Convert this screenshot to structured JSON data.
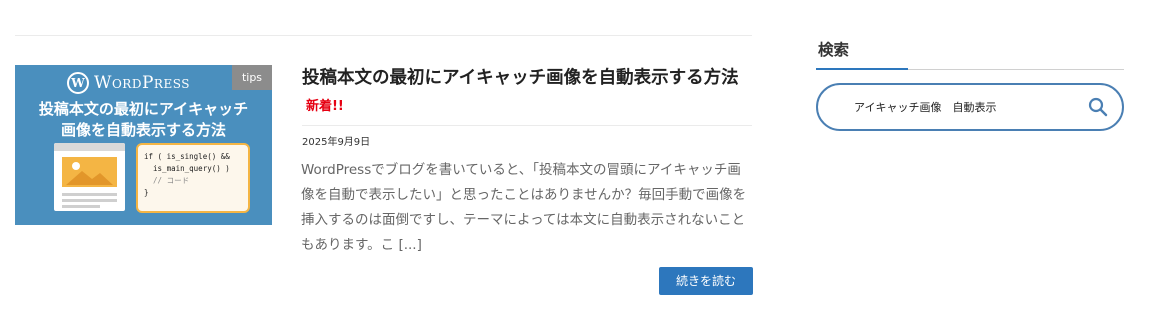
{
  "post": {
    "thumbnail": {
      "tag": "tips",
      "logo_text": "WordPress",
      "logo_mark": "W",
      "title_line1": "投稿本文の最初にアイキャッチ",
      "title_line2": "画像を自動表示する方法",
      "code_lines": [
        "if ( is_single() &&",
        "  is_main_query() )",
        "  // コード",
        "}"
      ]
    },
    "title": "投稿本文の最初にアイキャッチ画像を自動表示する方法",
    "new_badge": "新着!!",
    "date": "2025年9月9日",
    "excerpt": "WordPressでブログを書いていると、「投稿本文の冒頭にアイキャッチ画像を自動で表示したい」と思ったことはありませんか？毎回手動で画像を挿入するのは面倒ですし、テーマによっては本文に自動表示されないこともあります。こ [...]",
    "read_more": "続きを読む"
  },
  "sidebar": {
    "search_title": "検索",
    "search_value": "アイキャッチ画像　自動表示",
    "search_icon": "search-icon"
  },
  "colors": {
    "accent": "#2d77bd",
    "thumb_bg": "#4a8fbe",
    "new_badge": "#e60012",
    "search_border": "#4a7fb3"
  }
}
